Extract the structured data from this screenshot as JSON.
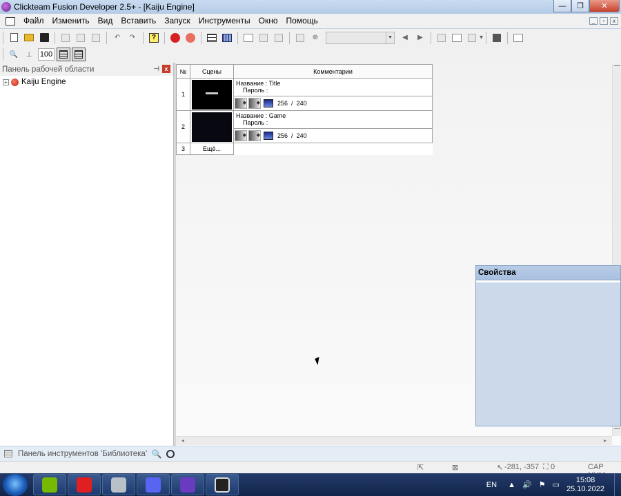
{
  "window": {
    "title": "Clickteam Fusion Developer 2.5+ - [Kaiju Engine]",
    "minimize": "—",
    "maximize": "❐",
    "close": "✕"
  },
  "menu": {
    "items": [
      "Файл",
      "Изменить",
      "Вид",
      "Вставить",
      "Запуск",
      "Инструменты",
      "Окно",
      "Помощь"
    ]
  },
  "toolbar": {
    "help_glyph": "?",
    "zoom_value": "100",
    "frame_combo_value": ""
  },
  "workspace": {
    "title": "Панель рабочей области",
    "pin_glyph": "⊣",
    "close_glyph": "x",
    "tree": [
      {
        "label": "Kaiju Engine",
        "expander": "+"
      }
    ]
  },
  "storyboard": {
    "headers": {
      "num": "№",
      "scenes": "Сцены",
      "comments": "Комментарии"
    },
    "frames": [
      {
        "num": "1",
        "name_label": "Название :",
        "name": "Title",
        "password_label": "Пароль :",
        "width": "256",
        "sep": "/",
        "height": "240"
      },
      {
        "num": "2",
        "name_label": "Название :",
        "name": "Game",
        "password_label": "Пароль :",
        "width": "256",
        "sep": "/",
        "height": "240"
      }
    ],
    "more": {
      "num": "3",
      "label": "Ещё..."
    }
  },
  "properties": {
    "title": "Свойства"
  },
  "library": {
    "label": "Панель инструментов 'Библиотека'",
    "search_glyph": "🔍"
  },
  "statusbar": {
    "coords": "-281, -357",
    "layer": "0",
    "keys": "CAP NUM"
  },
  "taskbar": {
    "lang": "EN",
    "time": "15:08",
    "date": "25.10.2022",
    "apps": [
      "nvidia-icon",
      "opera-icon",
      "disk-icon",
      "discord-icon",
      "fusion-icon",
      "obs-icon"
    ]
  },
  "colors": {
    "titlebar": "#c9dbf0",
    "properties_bg": "#ccd9ea",
    "taskbar": "#12254a"
  }
}
